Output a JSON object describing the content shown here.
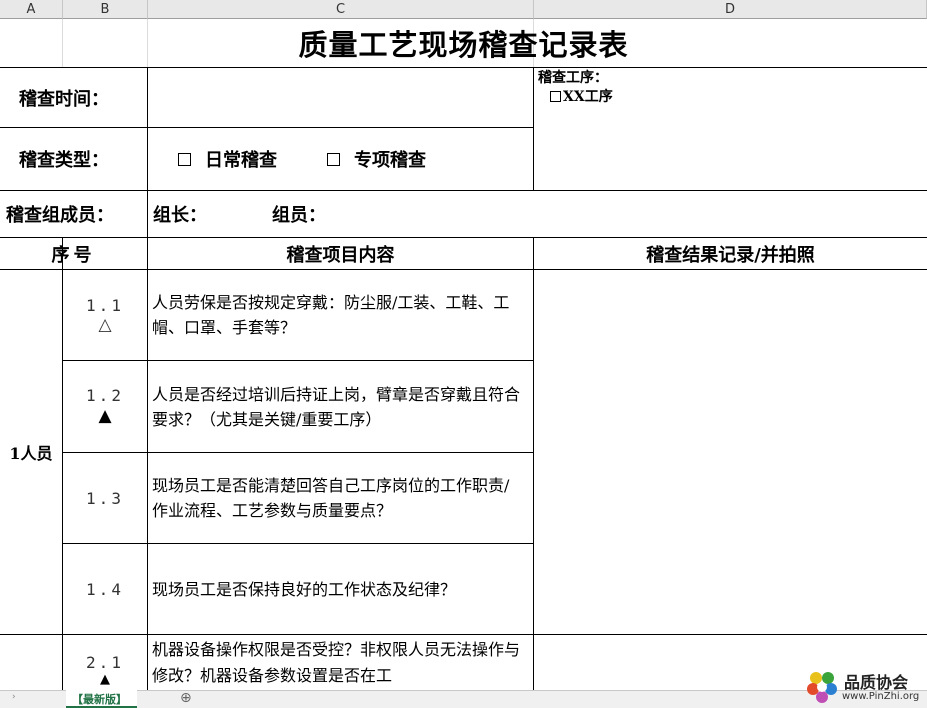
{
  "columns": [
    "A",
    "B",
    "C",
    "D"
  ],
  "title": "质量工艺现场稽查记录表",
  "fields": {
    "time_label": "稽查时间：",
    "type_label": "稽查类型：",
    "type_option_1": "日常稽查",
    "type_option_2": "专项稽查",
    "process_label": "稽查工序：",
    "process_option": "XX工序",
    "members_label": "稽查组成员：",
    "leader_label": "组长：",
    "member_label": "组员："
  },
  "table_header": {
    "no": "序号",
    "content": "稽查项目内容",
    "result": "稽查结果记录/并拍照"
  },
  "groups": [
    {
      "name": "1人员"
    }
  ],
  "items": [
    {
      "no": "1.1",
      "mark": "△",
      "content": "人员劳保是否按规定穿戴：防尘服/工装、工鞋、工帽、口罩、手套等？"
    },
    {
      "no": "1.2",
      "mark": "▲",
      "content": "人员是否经过培训后持证上岗，臂章是否穿戴且符合要求？（尤其是关键/重要工序）"
    },
    {
      "no": "1.3",
      "mark": "",
      "content": "现场员工是否能清楚回答自己工序岗位的工作职责/作业流程、工艺参数与质量要点？"
    },
    {
      "no": "1.4",
      "mark": "",
      "content": "现场员工是否保持良好的工作状态及纪律？"
    },
    {
      "no": "2.1",
      "mark": "▲",
      "content": "机器设备操作权限是否受控？非权限人员无法操作与修改？机器设备参数设置是否在工"
    }
  ],
  "sheet_tab": "【最新版】",
  "add_sheet": "⊕",
  "logo": {
    "name": "品质协会",
    "url": "www.PinZhi.org"
  }
}
